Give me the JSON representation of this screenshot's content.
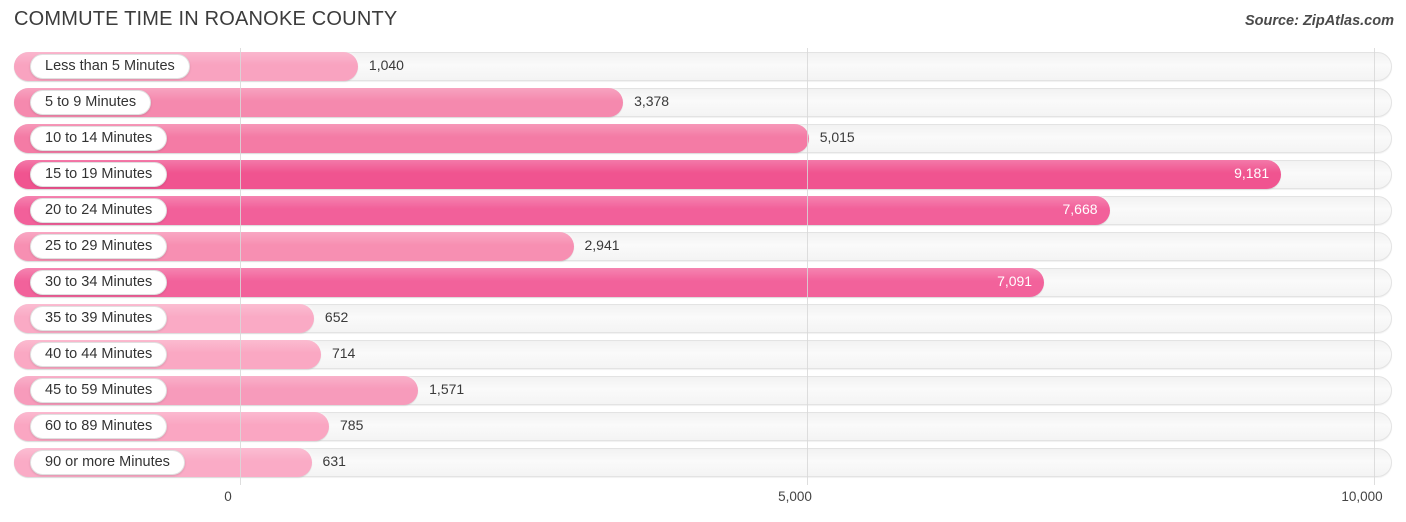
{
  "header": {
    "title": "COMMUTE TIME IN ROANOKE COUNTY",
    "source": "Source: ZipAtlas.com"
  },
  "chart_data": {
    "type": "bar",
    "orientation": "horizontal",
    "title": "COMMUTE TIME IN ROANOKE COUNTY",
    "source": "Source: ZipAtlas.com",
    "xlabel": "",
    "ylabel": "",
    "xlim": [
      0,
      10000
    ],
    "grid": true,
    "legend": "none",
    "tick_labels": [
      "0",
      "5,000",
      "10,000"
    ],
    "tick_values": [
      0,
      5000,
      10000
    ],
    "categories": [
      "Less than 5 Minutes",
      "5 to 9 Minutes",
      "10 to 14 Minutes",
      "15 to 19 Minutes",
      "20 to 24 Minutes",
      "25 to 29 Minutes",
      "30 to 34 Minutes",
      "35 to 39 Minutes",
      "40 to 44 Minutes",
      "45 to 59 Minutes",
      "60 to 89 Minutes",
      "90 or more Minutes"
    ],
    "values": [
      1040,
      3378,
      5015,
      9181,
      7668,
      2941,
      7091,
      652,
      714,
      1571,
      785,
      631
    ],
    "value_labels": [
      "1,040",
      "3,378",
      "5,015",
      "9,181",
      "7,668",
      "2,941",
      "7,091",
      "652",
      "714",
      "1,571",
      "785",
      "631"
    ],
    "bar_colors": [
      "#F9A3C0",
      "#F589AE",
      "#F47BA5",
      "#F05490",
      "#F2609A",
      "#F78FB2",
      "#F2629B",
      "#FAAAC5",
      "#FAA8C3",
      "#F79BBB",
      "#FAA6C2",
      "#FAABC6"
    ],
    "label_placement": [
      "outside",
      "outside",
      "outside",
      "inside",
      "inside",
      "outside",
      "inside",
      "outside",
      "outside",
      "outside",
      "outside",
      "outside"
    ]
  },
  "colors": {
    "accent": "#F2609A",
    "track": "#F5F5F5",
    "gridline": "#d8d8d8",
    "text": "#3c3c3c"
  }
}
